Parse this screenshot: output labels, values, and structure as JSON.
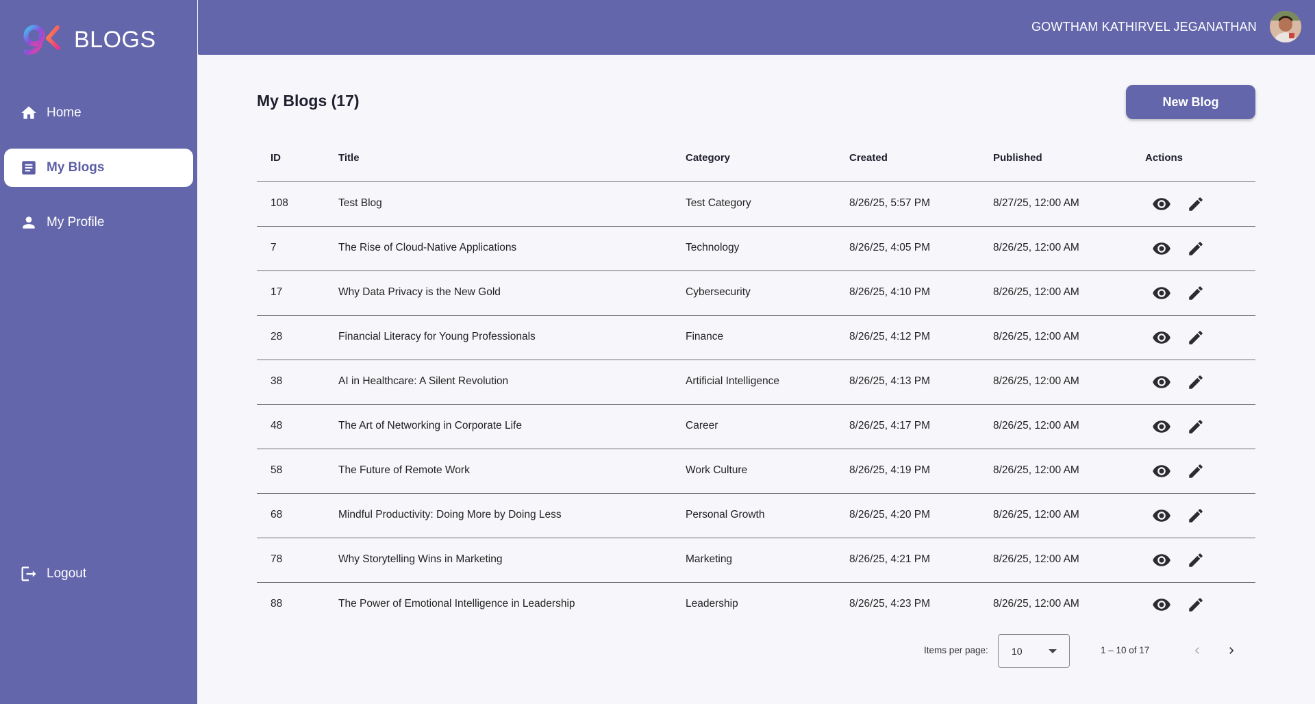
{
  "app": {
    "brand": "BLOGS"
  },
  "sidebar": {
    "items": [
      {
        "label": "Home",
        "icon": "home-icon"
      },
      {
        "label": "My Blogs",
        "icon": "article-icon"
      },
      {
        "label": "My Profile",
        "icon": "person-icon"
      }
    ],
    "logout_label": "Logout"
  },
  "header": {
    "user_name": "GOWTHAM KATHIRVEL JEGANATHAN"
  },
  "main": {
    "title": "My Blogs (17)",
    "new_blog_label": "New Blog"
  },
  "table": {
    "columns": [
      "ID",
      "Title",
      "Category",
      "Created",
      "Published",
      "Actions"
    ],
    "rows": [
      {
        "id": "108",
        "title": "Test Blog",
        "category": "Test Category",
        "created": "8/26/25, 5:57 PM",
        "published": "8/27/25, 12:00 AM"
      },
      {
        "id": "7",
        "title": "The Rise of Cloud-Native Applications",
        "category": "Technology",
        "created": "8/26/25, 4:05 PM",
        "published": "8/26/25, 12:00 AM"
      },
      {
        "id": "17",
        "title": "Why Data Privacy is the New Gold",
        "category": "Cybersecurity",
        "created": "8/26/25, 4:10 PM",
        "published": "8/26/25, 12:00 AM"
      },
      {
        "id": "28",
        "title": "Financial Literacy for Young Professionals",
        "category": "Finance",
        "created": "8/26/25, 4:12 PM",
        "published": "8/26/25, 12:00 AM"
      },
      {
        "id": "38",
        "title": "AI in Healthcare: A Silent Revolution",
        "category": "Artificial Intelligence",
        "created": "8/26/25, 4:13 PM",
        "published": "8/26/25, 12:00 AM"
      },
      {
        "id": "48",
        "title": "The Art of Networking in Corporate Life",
        "category": "Career",
        "created": "8/26/25, 4:17 PM",
        "published": "8/26/25, 12:00 AM"
      },
      {
        "id": "58",
        "title": "The Future of Remote Work",
        "category": "Work Culture",
        "created": "8/26/25, 4:19 PM",
        "published": "8/26/25, 12:00 AM"
      },
      {
        "id": "68",
        "title": "Mindful Productivity: Doing More by Doing Less",
        "category": "Personal Growth",
        "created": "8/26/25, 4:20 PM",
        "published": "8/26/25, 12:00 AM"
      },
      {
        "id": "78",
        "title": "Why Storytelling Wins in Marketing",
        "category": "Marketing",
        "created": "8/26/25, 4:21 PM",
        "published": "8/26/25, 12:00 AM"
      },
      {
        "id": "88",
        "title": "The Power of Emotional Intelligence in Leadership",
        "category": "Leadership",
        "created": "8/26/25, 4:23 PM",
        "published": "8/26/25, 12:00 AM"
      }
    ]
  },
  "paginator": {
    "items_per_page_label": "Items per page:",
    "page_size": "10",
    "range_label": "1 – 10 of 17"
  },
  "colors": {
    "primary": "#6366aa",
    "background": "#f7f7fb"
  }
}
